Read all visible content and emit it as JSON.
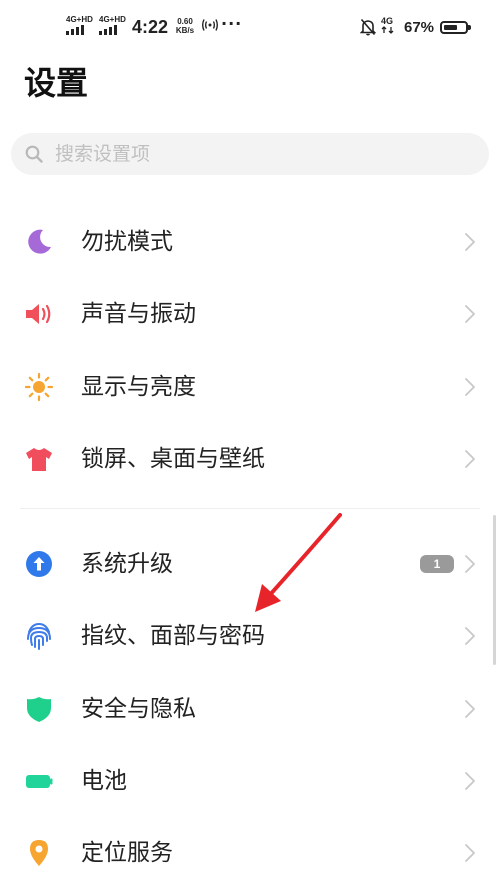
{
  "status_bar": {
    "sim1_network": "4G+HD",
    "sim2_network": "4G+HD",
    "time": "4:22",
    "speed_value": "0.60",
    "speed_unit": "KB/s",
    "more": "···",
    "data_network": "4G",
    "battery_percent": "67%",
    "battery_level": 0.67
  },
  "header": {
    "title": "设置"
  },
  "search": {
    "placeholder": "搜索设置项"
  },
  "settings": {
    "items": [
      {
        "label": "勿扰模式",
        "icon": "moon-icon",
        "color": "#a56ad8"
      },
      {
        "label": "声音与振动",
        "icon": "speaker-icon",
        "color": "#f0505a"
      },
      {
        "label": "显示与亮度",
        "icon": "sun-icon",
        "color": "#f7a531"
      },
      {
        "label": "锁屏、桌面与壁纸",
        "icon": "shirt-icon",
        "color": "#f04e5c"
      },
      {
        "label": "系统升级",
        "icon": "upgrade-arrow-icon",
        "color": "#2f79ea",
        "badge": "1"
      },
      {
        "label": "指纹、面部与密码",
        "icon": "fingerprint-icon",
        "color": "#3f7cea"
      },
      {
        "label": "安全与隐私",
        "icon": "shield-icon",
        "color": "#1fcf8c"
      },
      {
        "label": "电池",
        "icon": "battery-icon",
        "color": "#20d49a"
      },
      {
        "label": "定位服务",
        "icon": "location-pin-icon",
        "color": "#f7a531"
      }
    ]
  },
  "colors": {
    "annotation_arrow": "#e8242b",
    "chevron": "#c8c8c8",
    "badge": "#9a9a9a"
  }
}
